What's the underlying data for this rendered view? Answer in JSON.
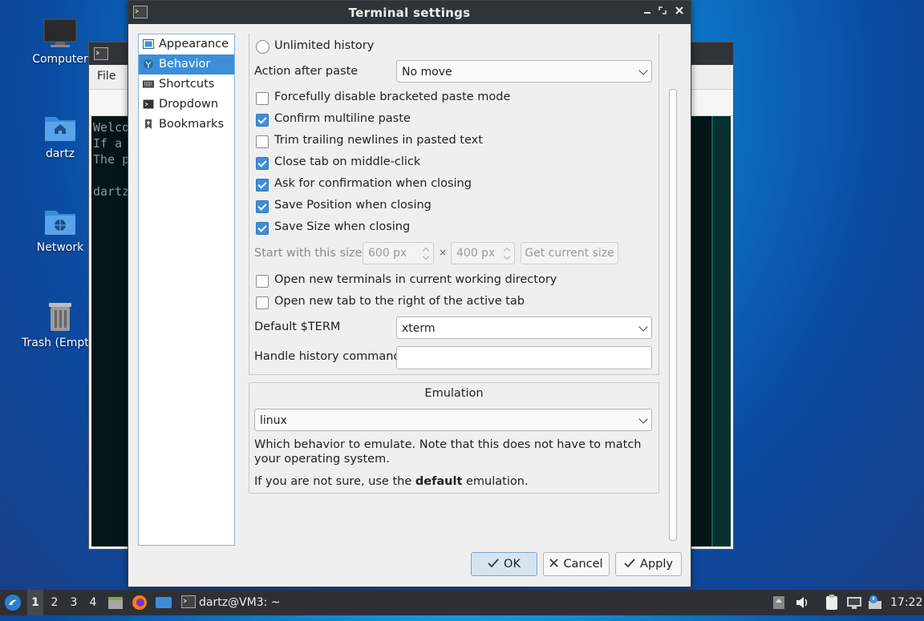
{
  "desktop": {
    "icons": [
      {
        "label": "Computer",
        "icon": "monitor-icon"
      },
      {
        "label": "dartz",
        "icon": "home-folder-icon"
      },
      {
        "label": "Network",
        "icon": "network-folder-icon"
      },
      {
        "label": "Trash (Empty)",
        "icon": "trash-icon"
      }
    ]
  },
  "background_terminal": {
    "menu_file": "File",
    "lines": [
      "Welco",
      "If a",
      "The p",
      "",
      "dartz"
    ]
  },
  "dialog": {
    "title": "Terminal settings",
    "sidebar": [
      {
        "label": "Appearance",
        "icon": "appearance-icon"
      },
      {
        "label": "Behavior",
        "icon": "behavior-icon",
        "selected": true
      },
      {
        "label": "Shortcuts",
        "icon": "keyboard-icon"
      },
      {
        "label": "Dropdown",
        "icon": "terminal-icon"
      },
      {
        "label": "Bookmarks",
        "icon": "bookmark-icon"
      }
    ],
    "behavior": {
      "unlimited_history": "Unlimited history",
      "action_after_paste_label": "Action after paste",
      "action_after_paste_value": "No move",
      "checkboxes": [
        {
          "label": "Forcefully disable bracketed paste mode",
          "checked": false
        },
        {
          "label": "Confirm multiline paste",
          "checked": true
        },
        {
          "label": "Trim trailing newlines in pasted text",
          "checked": false
        },
        {
          "label": "Close tab on middle-click",
          "checked": true
        },
        {
          "label": "Ask for confirmation when closing",
          "checked": true
        },
        {
          "label": "Save Position when closing",
          "checked": true
        },
        {
          "label": "Save Size when closing",
          "checked": true
        }
      ],
      "start_size_label": "Start with this size:",
      "width_value": "600 px",
      "times": "×",
      "height_value": "400 px",
      "get_current_size": "Get current size",
      "checkboxes2": [
        {
          "label": "Open new terminals in current working directory",
          "checked": false
        },
        {
          "label": "Open new tab to the right of the active tab",
          "checked": false
        }
      ],
      "default_term_label": "Default $TERM",
      "default_term_value": "xterm",
      "handle_history_label": "Handle history command",
      "handle_history_value": ""
    },
    "emulation": {
      "title": "Emulation",
      "value": "linux",
      "desc": "Which behavior to emulate. Note that this does not have to match your operating system.",
      "hint_prefix": "If you are not sure, use the ",
      "hint_bold": "default",
      "hint_suffix": " emulation."
    },
    "buttons": {
      "ok": "OK",
      "cancel": "Cancel",
      "apply": "Apply"
    }
  },
  "taskbar": {
    "workspaces": [
      "1",
      "2",
      "3",
      "4"
    ],
    "task_label": "dartz@VM3: ~",
    "clock": "17:22"
  }
}
